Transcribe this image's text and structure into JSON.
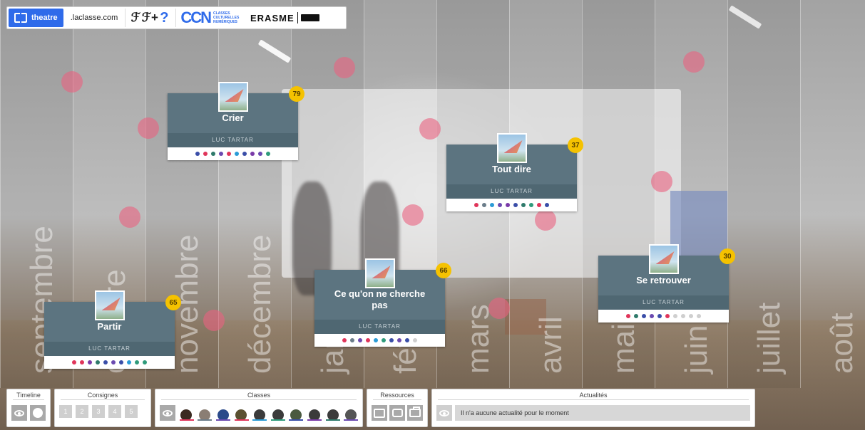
{
  "topbar": {
    "app_label": "theatre",
    "site_link": ".laclasse.com",
    "ccn_mark": "CCN",
    "ccn_sub": "CLASSES CULTURELLES NUMÉRIQUES",
    "erasme": "ERASME"
  },
  "months": [
    "septembre",
    "octobre",
    "novembre",
    "décembre",
    "janvier",
    "février",
    "mars",
    "avril",
    "mai",
    "juin",
    "juillet",
    "août"
  ],
  "cards": [
    {
      "title": "Crier",
      "author": "LUC TARTAR",
      "count": "79",
      "dots": [
        "#3a4ea8",
        "#e0355a",
        "#2f7a6b",
        "#6b4ab0",
        "#e0355a",
        "#2b9bd6",
        "#3a4ea8",
        "#7a3aa8",
        "#6b4ab0",
        "#2f9b7b"
      ]
    },
    {
      "title": "Tout dire",
      "author": "LUC TARTAR",
      "count": "37",
      "dots": [
        "#e0355a",
        "#6b7d8a",
        "#2b9bd6",
        "#6b4ab0",
        "#7a3aa8",
        "#3a4ea8",
        "#2f7a6b",
        "#2f9b7b",
        "#e0355a",
        "#3a4ea8"
      ]
    },
    {
      "title": "Partir",
      "author": "LUC TARTAR",
      "count": "65",
      "dots": [
        "#e0355a",
        "#e0355a",
        "#7a3aa8",
        "#2f7a6b",
        "#3a4ea8",
        "#6b4ab0",
        "#3a4ea8",
        "#2b9bd6",
        "#2f9b7b",
        "#2f9b7b"
      ]
    },
    {
      "title": "Ce qu'on ne cherche pas",
      "author": "LUC TARTAR",
      "count": "66",
      "dots": [
        "#e0355a",
        "#6b7d8a",
        "#6b4ab0",
        "#e0355a",
        "#2b9bd6",
        "#2f9b7b",
        "#3a4ea8",
        "#6b4ab0",
        "#3a4ea8",
        "#cfcfcf"
      ]
    },
    {
      "title": "Se retrouver",
      "author": "LUC TARTAR",
      "count": "30",
      "dots": [
        "#e0355a",
        "#2f7a6b",
        "#3a4ea8",
        "#6b4ab0",
        "#3a4ea8",
        "#e0355a",
        "#cfcfcf",
        "#cfcfcf",
        "#cfcfcf",
        "#cfcfcf"
      ]
    }
  ],
  "panels": {
    "timeline": {
      "title": "Timeline"
    },
    "consignes": {
      "title": "Consignes",
      "items": [
        "1",
        "2",
        "3",
        "4",
        "5"
      ]
    },
    "classes": {
      "title": "Classes",
      "avatars": [
        {
          "face": "#3b2a20",
          "bar": "#e0355a"
        },
        {
          "face": "#8a7e74",
          "bar": "#6b7d8a"
        },
        {
          "face": "#2a4a8a",
          "bar": "#6b4ab0"
        },
        {
          "face": "#5a5030",
          "bar": "#e0355a"
        },
        {
          "face": "#3b3b3b",
          "bar": "#2b9bd6"
        },
        {
          "face": "#3b3b3b",
          "bar": "#2f9b7b"
        },
        {
          "face": "#4a5a40",
          "bar": "#3a4ea8"
        },
        {
          "face": "#3b3b3b",
          "bar": "#7a3aa8"
        },
        {
          "face": "#3b3b3b",
          "bar": "#2f7a6b"
        },
        {
          "face": "#555555",
          "bar": "#6b4ab0"
        }
      ]
    },
    "ressources": {
      "title": "Ressources"
    },
    "actualites": {
      "title": "Actualités",
      "message": "Il n'a aucune actualité pour le moment"
    }
  },
  "colors": {
    "accent": "#2f6bea",
    "card_bg": "#5c7480",
    "badge": "#f5c200",
    "bg_dot": "#e9627f"
  }
}
